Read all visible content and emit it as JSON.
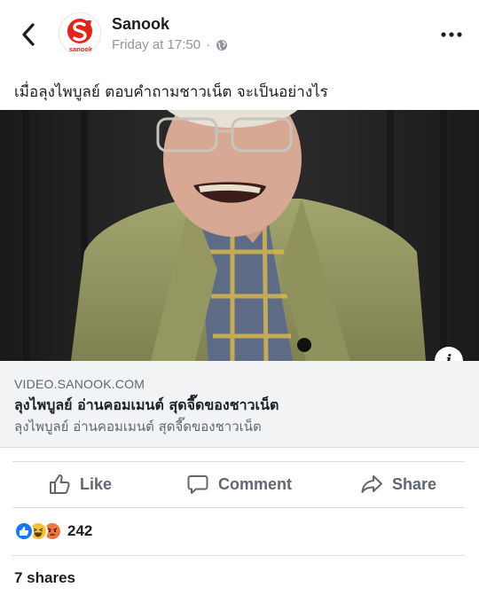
{
  "post": {
    "page_name": "Sanook",
    "avatar_text": "sanook",
    "timestamp": "Friday at 17:50",
    "visibility_separator": "·",
    "visibility_icon": "globe-icon",
    "text": "เมื่อลุงไพบูลย์ ตอบคำถามชาวเน็ต จะเป็นอย่างไร"
  },
  "link": {
    "domain": "VIDEO.SANOOK.COM",
    "title": "ลุงไพบูลย์ อ่านคอมเมนต์ สุดจี๊ดของชาวเน็ต",
    "description": "ลุงไพบูลย์ อ่านคอมเมนต์ สุดจี๊ดของชาวเน็ต",
    "info_label": "i"
  },
  "actions": {
    "like": "Like",
    "comment": "Comment",
    "share": "Share"
  },
  "stats": {
    "reaction_count": "242",
    "reactions": [
      "like",
      "haha",
      "angry"
    ],
    "shares": "7 shares"
  },
  "colors": {
    "brand_red": "#e2231a",
    "like_blue": "#1877f2",
    "reaction_yellow": "#f7c331",
    "muted_text": "#606770"
  }
}
